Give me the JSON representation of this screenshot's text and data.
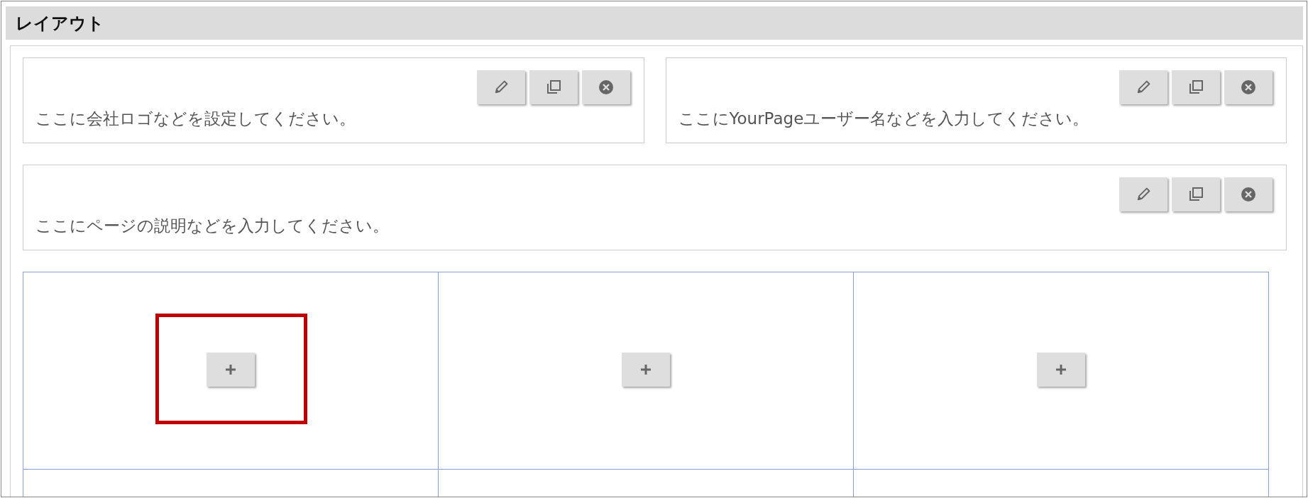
{
  "panel": {
    "title": "レイアウト"
  },
  "card_rows": [
    [
      {
        "text": "ここに会社ロゴなどを設定してください。",
        "actions": [
          {
            "kind": "edit"
          },
          {
            "kind": "duplicate"
          },
          {
            "kind": "delete"
          }
        ]
      },
      {
        "text": "ここにYourPageユーザー名などを入力してください。",
        "actions": [
          {
            "kind": "edit"
          },
          {
            "kind": "duplicate"
          },
          {
            "kind": "delete"
          }
        ]
      }
    ],
    [
      {
        "text": "ここにページの説明などを入力してください。",
        "actions": [
          {
            "kind": "edit"
          },
          {
            "kind": "duplicate"
          },
          {
            "kind": "delete"
          }
        ]
      }
    ]
  ],
  "grid": {
    "rows": [
      {
        "cells": [
          {
            "add_button": true,
            "highlighted": true
          },
          {
            "add_button": true,
            "highlighted": false
          },
          {
            "add_button": true,
            "highlighted": false
          }
        ]
      },
      {
        "cells": [
          {
            "add_button": false,
            "highlighted": false
          },
          {
            "add_button": false,
            "highlighted": false
          },
          {
            "add_button": false,
            "highlighted": false
          }
        ]
      }
    ]
  }
}
